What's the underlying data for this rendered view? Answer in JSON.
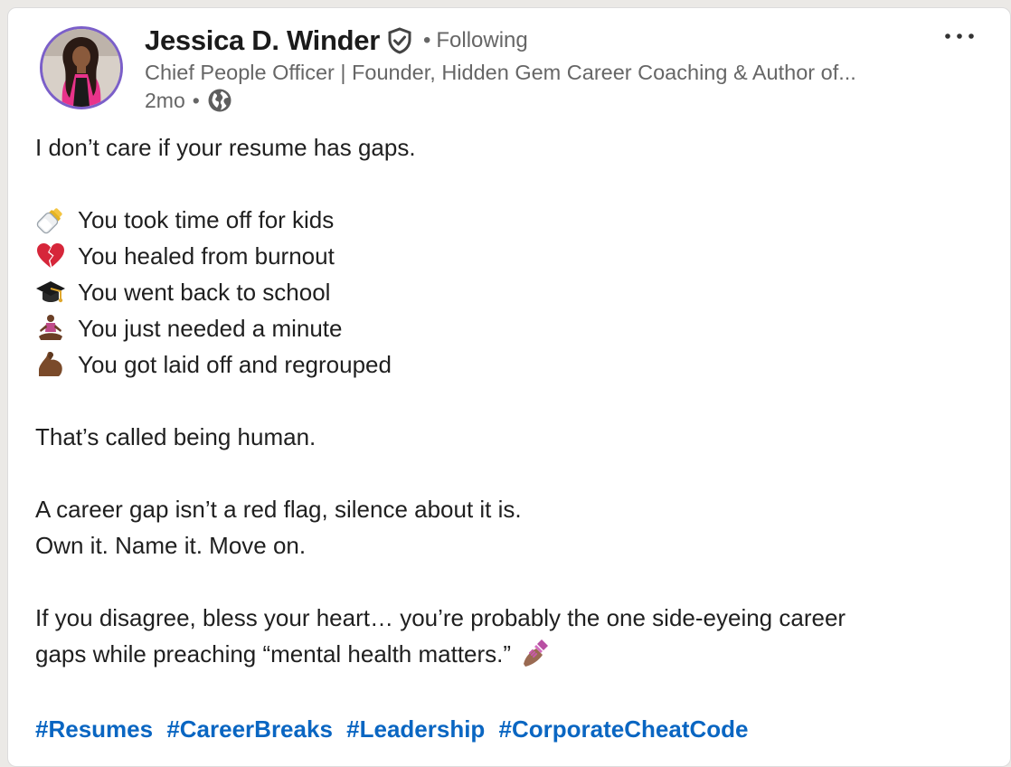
{
  "author": {
    "name": "Jessica D. Winder",
    "follow_status": "Following",
    "separator": "•",
    "headline": "Chief People Officer | Founder, Hidden Gem Career Coaching & Author of...",
    "posted_ago": "2mo",
    "visibility_icon": "globe-icon",
    "verified_icon": "verified-shield-icon"
  },
  "post": {
    "intro": "I don’t care if your resume has gaps.",
    "bullets": [
      {
        "icon": "baby-bottle-icon",
        "text": "You took time off for kids"
      },
      {
        "icon": "broken-heart-icon",
        "text": "You healed from burnout"
      },
      {
        "icon": "graduation-cap-icon",
        "text": "You went back to school"
      },
      {
        "icon": "meditation-icon",
        "text": "You just needed a minute"
      },
      {
        "icon": "flexed-bicep-icon",
        "text": "You got laid off and regrouped"
      }
    ],
    "statement": "That’s called being human.",
    "line_a": "A career gap isn’t a red flag, silence about it is.",
    "line_b": "Own it. Name it. Move on.",
    "closing_1": "If you disagree, bless your heart… you’re probably the one side-eyeing career",
    "closing_2": "gaps while preaching “mental health matters.”",
    "closing_icon": "nail-polish-icon"
  },
  "hashtags": [
    "#Resumes",
    "#CareerBreaks",
    "#Leadership",
    "#CorporateCheatCode"
  ],
  "colors": {
    "link": "#0a66c2",
    "muted_text": "#666666",
    "avatar_ring": "#7b5fc9"
  }
}
